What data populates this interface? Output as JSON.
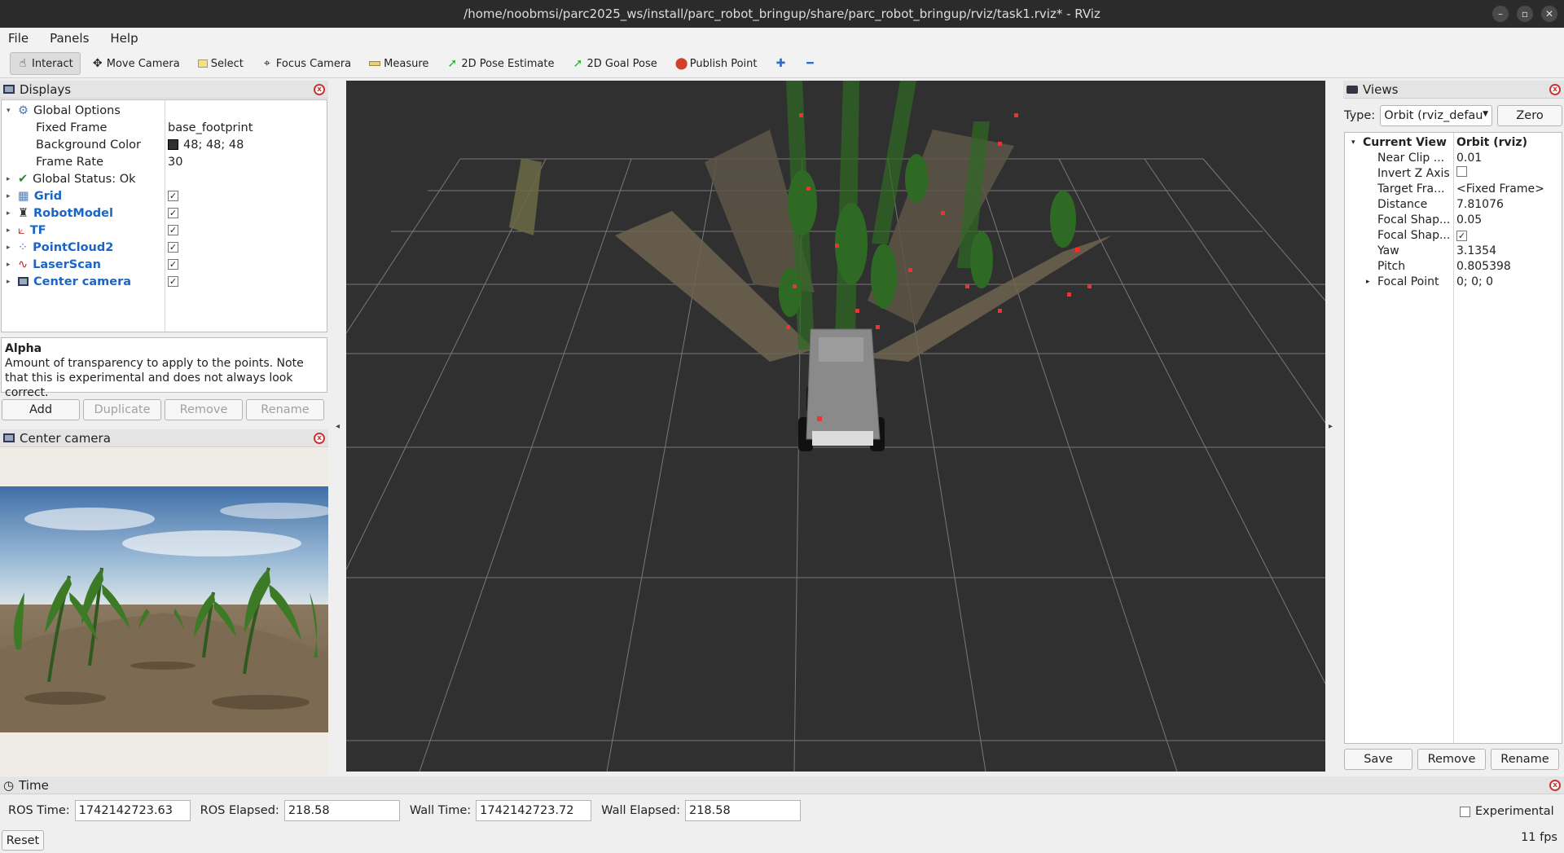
{
  "window": {
    "title": "/home/noobmsi/parc2025_ws/install/parc_robot_bringup/share/parc_robot_bringup/rviz/task1.rviz* - RViz"
  },
  "menu": [
    "File",
    "Panels",
    "Help"
  ],
  "toolbar": {
    "interact": "Interact",
    "move_camera": "Move Camera",
    "select": "Select",
    "focus_camera": "Focus Camera",
    "measure": "Measure",
    "pose_estimate": "2D Pose Estimate",
    "goal_pose": "2D Goal Pose",
    "publish_point": "Publish Point"
  },
  "displays": {
    "title": "Displays",
    "global_options": "Global Options",
    "fixed_frame_label": "Fixed Frame",
    "fixed_frame_value": "base_footprint",
    "bg_color_label": "Background Color",
    "bg_color_value": "48; 48; 48",
    "frame_rate_label": "Frame Rate",
    "frame_rate_value": "30",
    "global_status": "Global Status: Ok",
    "items": [
      {
        "label": "Grid",
        "checked": true
      },
      {
        "label": "RobotModel",
        "checked": true
      },
      {
        "label": "TF",
        "checked": true
      },
      {
        "label": "PointCloud2",
        "checked": true
      },
      {
        "label": "LaserScan",
        "checked": true
      },
      {
        "label": "Center camera",
        "checked": true
      }
    ],
    "desc_title": "Alpha",
    "desc_text": "Amount of transparency to apply to the points. Note that this is experimental and does not always look correct.",
    "buttons": {
      "add": "Add",
      "duplicate": "Duplicate",
      "remove": "Remove",
      "rename": "Rename"
    }
  },
  "camera_panel": {
    "title": "Center camera"
  },
  "views": {
    "title": "Views",
    "type_label": "Type:",
    "type_value": "Orbit (rviz_defau",
    "zero": "Zero",
    "current_view": "Current View",
    "current_view_value": "Orbit (rviz)",
    "props": [
      {
        "k": "Near Clip ...",
        "v": "0.01"
      },
      {
        "k": "Invert Z Axis",
        "v": ""
      },
      {
        "k": "Target Fra...",
        "v": "<Fixed Frame>"
      },
      {
        "k": "Distance",
        "v": "7.81076"
      },
      {
        "k": "Focal Shap...",
        "v": "0.05"
      },
      {
        "k": "Focal Shap...",
        "v": ""
      },
      {
        "k": "Yaw",
        "v": "3.1354"
      },
      {
        "k": "Pitch",
        "v": "0.805398"
      },
      {
        "k": "Focal Point",
        "v": "0; 0; 0"
      }
    ],
    "buttons": {
      "save": "Save",
      "remove": "Remove",
      "rename": "Rename"
    }
  },
  "time": {
    "title": "Time",
    "ros_time_label": "ROS Time:",
    "ros_time": "1742142723.63",
    "ros_elapsed_label": "ROS Elapsed:",
    "ros_elapsed": "218.58",
    "wall_time_label": "Wall Time:",
    "wall_time": "1742142723.72",
    "wall_elapsed_label": "Wall Elapsed:",
    "wall_elapsed": "218.58",
    "experimental": "Experimental",
    "reset": "Reset",
    "fps": "11 fps"
  }
}
